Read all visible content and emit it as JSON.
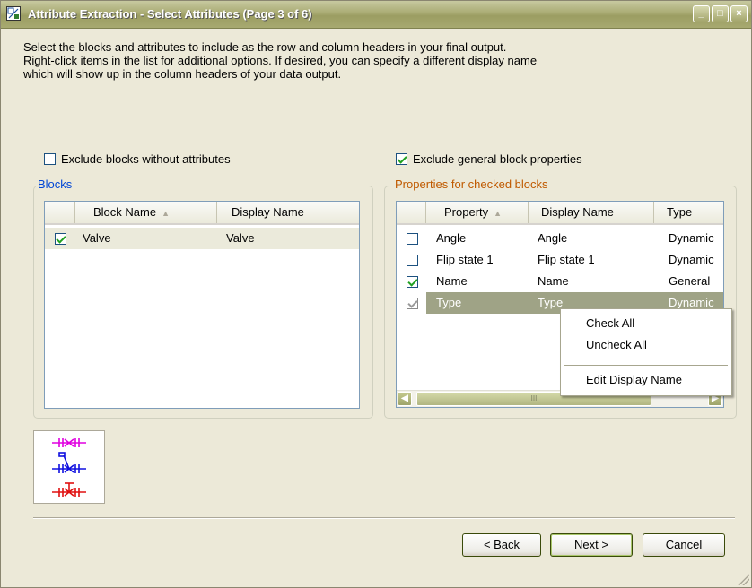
{
  "window": {
    "title": "Attribute Extraction - Select Attributes (Page 3 of 6)",
    "controls": {
      "minimize": "_",
      "maximize": "□",
      "close": "×"
    }
  },
  "intro_text": "Select the blocks and attributes to include as the row and column headers in your final output.\nRight-click items in the list for additional options. If desired, you can specify a different display name\nwhich will show up in the column headers of your data output.",
  "exclude_blocks": {
    "label": "Exclude blocks without attributes",
    "checked": false
  },
  "exclude_general": {
    "label": "Exclude general block properties",
    "checked": true
  },
  "blocks": {
    "title": "Blocks",
    "columns": [
      "Block Name",
      "Display Name"
    ],
    "sort_indicator": "▲",
    "rows": [
      {
        "checked": true,
        "block_name": "Valve",
        "display_name": "Valve"
      }
    ]
  },
  "properties": {
    "title": "Properties for checked blocks",
    "columns": [
      "Property",
      "Display Name",
      "Type"
    ],
    "sort_indicator": "▲",
    "rows": [
      {
        "checked": false,
        "property": "Angle",
        "display_name": "Angle",
        "type": "Dynamic"
      },
      {
        "checked": false,
        "property": "Flip state 1",
        "display_name": "Flip state 1",
        "type": "Dynamic"
      },
      {
        "checked": true,
        "property": "Name",
        "display_name": "Name",
        "type": "General"
      },
      {
        "checked": true,
        "property": "Type",
        "display_name": "Type",
        "type": "Dynamic"
      }
    ],
    "scroll_thumb_glyph": "III"
  },
  "context_menu": {
    "items": [
      "Check All",
      "Uncheck All",
      "Edit Display Name"
    ]
  },
  "buttons": {
    "back": "< Back",
    "next": "Next >",
    "cancel": "Cancel"
  },
  "colors": {
    "title_bar": "#a9ab73",
    "group_title": "#0046d5",
    "selected_row": "#9fa386",
    "check": "#21a121"
  }
}
